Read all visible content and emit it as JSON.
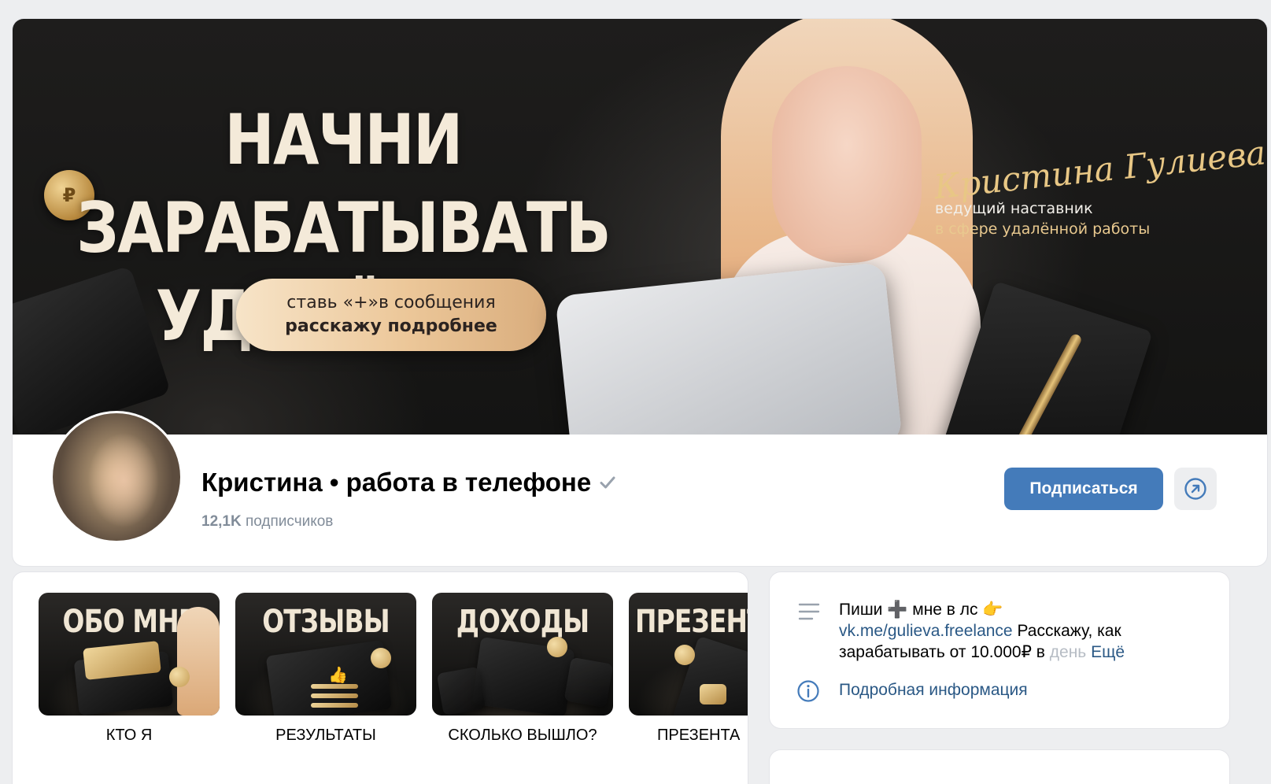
{
  "cover": {
    "title_line1": "НАЧНИ ЗАРАБАТЫВАТЬ",
    "title_line2": "УДАЛЁННО",
    "pill_line1": "ставь «+»в сообщения",
    "pill_line2": "расскажу подробнее",
    "signature": "Кристина Гулиева",
    "subtitle_line1": "ведущий наставник",
    "subtitle_line2": "в сфере удалённой работы"
  },
  "profile": {
    "name": "Кристина • работа в телефоне",
    "subscribers_count": "12,1K",
    "subscribers_label": "подписчиков",
    "subscribe_label": "Подписаться"
  },
  "playlists": [
    {
      "tile_text": "ОБО МНЕ",
      "caption": "КТО Я"
    },
    {
      "tile_text": "ОТЗЫВЫ",
      "caption": "РЕЗУЛЬТАТЫ"
    },
    {
      "tile_text": "ДОХОДЫ",
      "caption": "СКОЛЬКО ВЫШЛО?"
    },
    {
      "tile_text": "ПРЕЗЕНТА",
      "caption": "ПРЕЗЕНТА"
    }
  ],
  "info": {
    "desc_part1": "Пиши",
    "desc_part2": "мне в лс",
    "desc_link": "vk.me/gulieva.freelance",
    "desc_part3": " Расскажу, как",
    "desc_part4": "зарабатывать от 10.000₽ в ",
    "desc_fade": "день",
    "more_label": "Ещё",
    "details_label": "Подробная информация"
  },
  "colors": {
    "accent": "#447bba",
    "link": "#2a5885",
    "background": "#edeef0",
    "secondary_text": "#818c99"
  },
  "icons": {
    "verified": "check-icon",
    "share": "share-arrow-icon",
    "description": "lines-icon",
    "info": "info-icon"
  }
}
